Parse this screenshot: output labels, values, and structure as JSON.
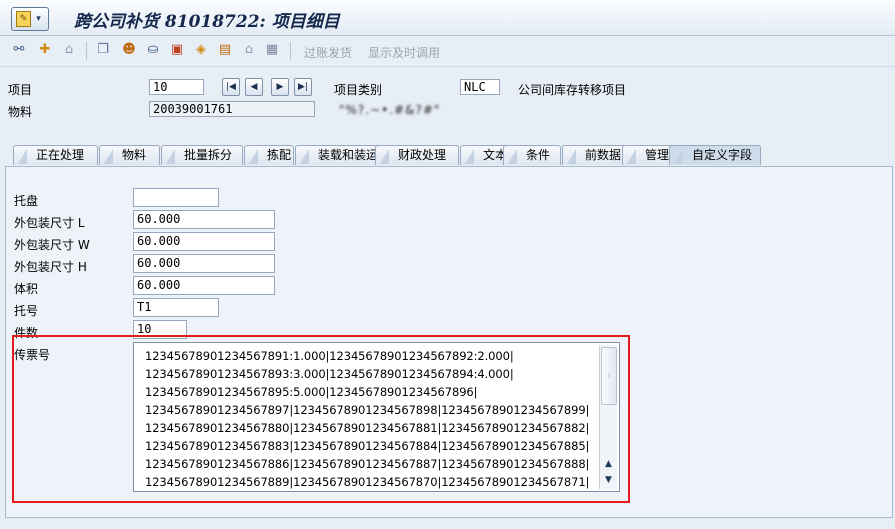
{
  "window": {
    "title": "跨公司补货 81018722: 项目细目"
  },
  "toolbar": {
    "icons": [
      "glasses-icon",
      "new-item-icon",
      "trash-icon",
      "copy-icon",
      "people-icon",
      "hat-icon",
      "truck-icon",
      "box-icon",
      "chart-icon",
      "house-icon",
      "grid-icon"
    ],
    "post_goods_issue": "过账发货",
    "display_timely": "显示及时调用"
  },
  "header": {
    "item_label": "项目",
    "item_value": "10",
    "item_category_label": "项目类别",
    "item_category_value": "NLC",
    "item_category_text": "公司间库存转移项目",
    "material_label": "物料",
    "material_value": "20039001761",
    "material_description": "\"%?.~•.#&?#\""
  },
  "tabs": [
    "正在处理",
    "物料",
    "批量拆分",
    "拣配",
    "装载和装运",
    "财政处理",
    "文本",
    "条件",
    "前数据",
    "管理",
    "自定义字段"
  ],
  "custom_fields": {
    "pallet_label": "托盘",
    "pallet_value": "",
    "length_label": "外包装尺寸 L",
    "length_value": "60.000",
    "width_label": "外包装尺寸 W",
    "width_value": "60.000",
    "height_label": "外包装尺寸 H",
    "height_value": "60.000",
    "volume_label": "体积",
    "volume_value": "60.000",
    "pallet_no_label": "托号",
    "pallet_no_value": "T1",
    "quantity_label": "件数",
    "quantity_value": "10",
    "ticket_label": "传票号",
    "ticket_lines": [
      "12345678901234567891:1.000|12345678901234567892:2.000|",
      "12345678901234567893:3.000|12345678901234567894:4.000|",
      "12345678901234567895:5.000|12345678901234567896|",
      "12345678901234567897|12345678901234567898|12345678901234567899|",
      "12345678901234567880|12345678901234567881|12345678901234567882|",
      "12345678901234567883|12345678901234567884|12345678901234567885|",
      "12345678901234567886|12345678901234567887|12345678901234567888|",
      "12345678901234567889|12345678901234567870|12345678901234567871|"
    ]
  },
  "colors": {
    "highlight_border": "#e31b1b",
    "background": "#e7eef6",
    "title": "#14284b"
  }
}
